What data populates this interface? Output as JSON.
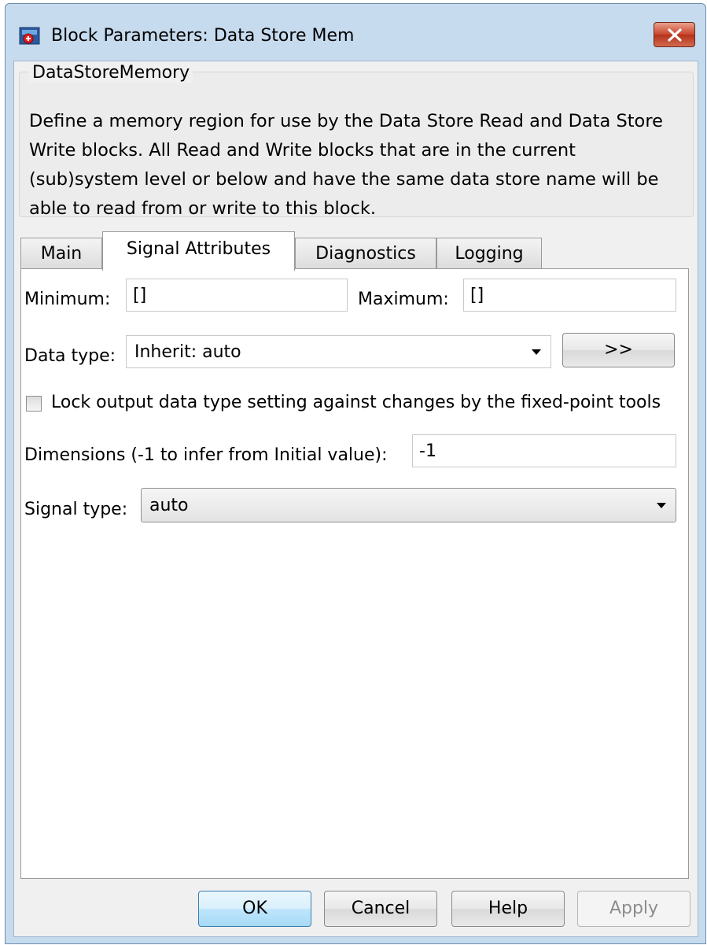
{
  "window": {
    "title": "Block Parameters: Data Store Mem",
    "close_icon": "close-icon",
    "app_icon": "simulink-block-icon"
  },
  "group": {
    "legend": "DataStoreMemory",
    "description": "Define a memory region for use by the Data Store Read and Data Store Write blocks. All Read and Write blocks that are in the current (sub)system level or below and have the same data store name will be able to read from or write to this block."
  },
  "tabs": [
    {
      "label": "Main",
      "active": false
    },
    {
      "label": "Signal Attributes",
      "active": true
    },
    {
      "label": "Diagnostics",
      "active": false
    },
    {
      "label": "Logging",
      "active": false
    }
  ],
  "signal_attributes": {
    "minimum_label": "Minimum:",
    "minimum_value": "[]",
    "maximum_label": "Maximum:",
    "maximum_value": "[]",
    "data_type_label": "Data type:",
    "data_type_value": "Inherit: auto",
    "data_type_assistant_label": ">>",
    "lock_label": "Lock output data type setting against changes by the fixed-point tools",
    "lock_checked": false,
    "dimensions_label": "Dimensions (-1 to infer from Initial value):",
    "dimensions_value": "-1",
    "signal_type_label": "Signal type:",
    "signal_type_value": "auto"
  },
  "buttons": {
    "ok": "OK",
    "cancel": "Cancel",
    "help": "Help",
    "apply": "Apply"
  },
  "colors": {
    "window_frame": "#c7dbef",
    "close_button": "#c9452c",
    "default_button": "#bee6fd"
  }
}
